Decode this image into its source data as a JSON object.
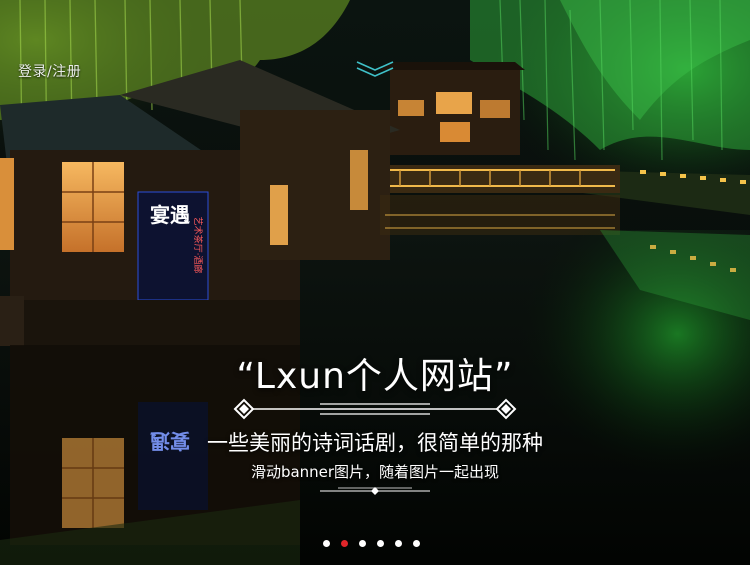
{
  "header": {
    "login_label": "登录/注册"
  },
  "banner": {
    "title": "“Lxun个人网站”",
    "subtitle": "一些美丽的诗词话剧，很简单的那种",
    "description": "滑动banner图片，随着图片一起出现",
    "sign_text": "宴遇",
    "sign_side_text": "艺术茶厅·酒廊"
  },
  "carousel": {
    "slide_count": 6,
    "active_index": 1
  },
  "colors": {
    "accent_active_dot": "#e0262a",
    "dot": "#ffffff",
    "scroll_hint": "#3fc0c8",
    "sign_text": "#ffffff",
    "sign_side_text": "#ff5a5a"
  }
}
